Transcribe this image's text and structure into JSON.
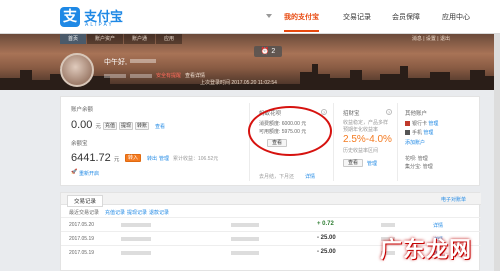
{
  "header": {
    "logo_cn": "支付宝",
    "logo_en": "ALIPAY",
    "nav": [
      "我的支付宝",
      "交易记录",
      "会员保障",
      "应用中心"
    ]
  },
  "banner": {
    "subnav": [
      "首页",
      "账户资产",
      "账户通",
      "应用"
    ],
    "toplinks": "消息 | 设置 | 退出",
    "notice": "⏰ 2",
    "username": "中午好,",
    "security_text": "安全有提醒",
    "security_link": "查看详情",
    "last_login": "上次登录时间 2017.05.20 11:02:54"
  },
  "balance": {
    "title": "账户余额",
    "amount": "0.00",
    "unit": "元",
    "btn_recharge": "充值",
    "btn_withdraw": "提现",
    "btn_transfer": "转账",
    "view": "查看"
  },
  "yuebao": {
    "title": "余额宝",
    "amount": "6441.72",
    "unit": "元",
    "btn_in": "转入",
    "out": "转出",
    "manage": "管理",
    "cumulative": "累计收益：106.52元",
    "flag": "重新开启"
  },
  "huabei": {
    "title": "蚂蚁花呗",
    "line1": "消费额度: 6000.00 元",
    "line2": "可用额度: 5975.00 元",
    "btn_view": "查看",
    "bottom": "去月结，下月还",
    "bottom_link": "详情"
  },
  "zhaocai": {
    "title": "招财宝",
    "desc1": "收益稳定，产品多样",
    "desc2": "预期年化收益率",
    "rate": "2.5%-4.0%",
    "desc3": "历史收益率区间",
    "btn_view": "查看",
    "manage": "管理"
  },
  "bindings": {
    "title": "其他账户",
    "bank": "银行卡",
    "bank_link": "管理",
    "phone": "手机",
    "phone_link": "管理",
    "add": "添加账户",
    "more": "花呗: 管理",
    "shop": "集分宝: 管理"
  },
  "transactions": {
    "tabs": [
      "交易记录",
      "充值记录",
      "提现记录",
      "退款记录"
    ],
    "subtitle_left": "最近交易记录",
    "subtitle_right": "电子对账单",
    "rows": [
      {
        "date": "2017.05.20",
        "amount": "+ 0.72",
        "detail": "详情"
      },
      {
        "date": "2017.05.19",
        "amount": "- 25.00",
        "detail": "详情"
      },
      {
        "date": "2017.05.19",
        "amount": "- 25.00",
        "detail": "详情"
      }
    ]
  },
  "watermark": "广东龙网",
  "colors": {
    "accent": "#1e88e5",
    "orange": "#f47a20",
    "red_circle": "#d6120f",
    "nav_active": "#e8490f"
  }
}
